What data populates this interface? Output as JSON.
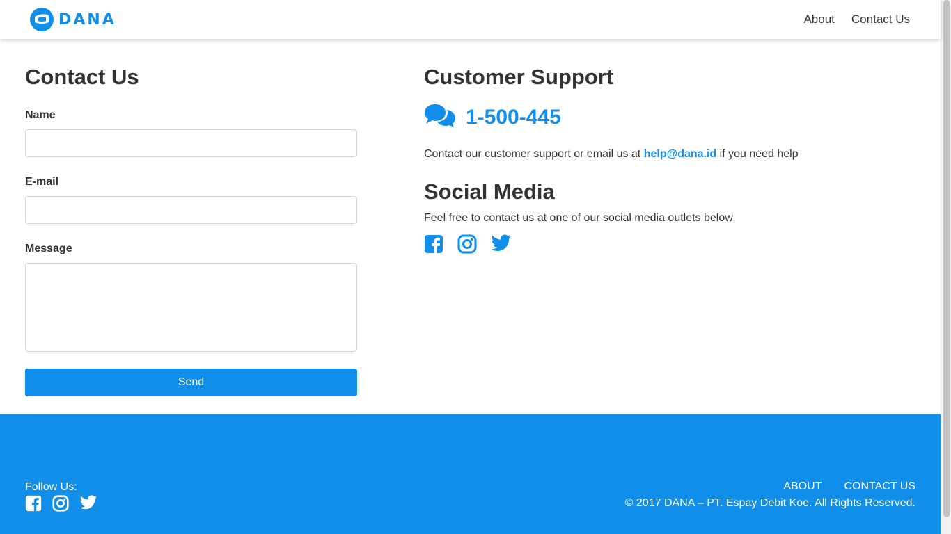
{
  "brand": {
    "name": "DANA",
    "color": "#118ee9"
  },
  "nav": {
    "about": "About",
    "contact": "Contact Us"
  },
  "contact_form": {
    "title": "Contact Us",
    "name_label": "Name",
    "name_value": "",
    "email_label": "E-mail",
    "email_value": "",
    "message_label": "Message",
    "message_value": "",
    "send_label": "Send"
  },
  "support": {
    "title": "Customer Support",
    "icon": "chat-bubbles-icon",
    "phone": "1-500-445",
    "text_before": "Contact our customer support or email us at ",
    "email": "help@dana.id",
    "text_after": " if you need help"
  },
  "social": {
    "title": "Social Media",
    "text": "Feel free to contact us at one of our social media outlets below",
    "icons": [
      "facebook-icon",
      "instagram-icon",
      "twitter-icon"
    ]
  },
  "footer": {
    "follow_label": "Follow Us:",
    "about": "ABOUT",
    "contact": "CONTACT US",
    "copyright": "© 2017 DANA – PT. Espay Debit Koe. All Rights Reserved."
  }
}
